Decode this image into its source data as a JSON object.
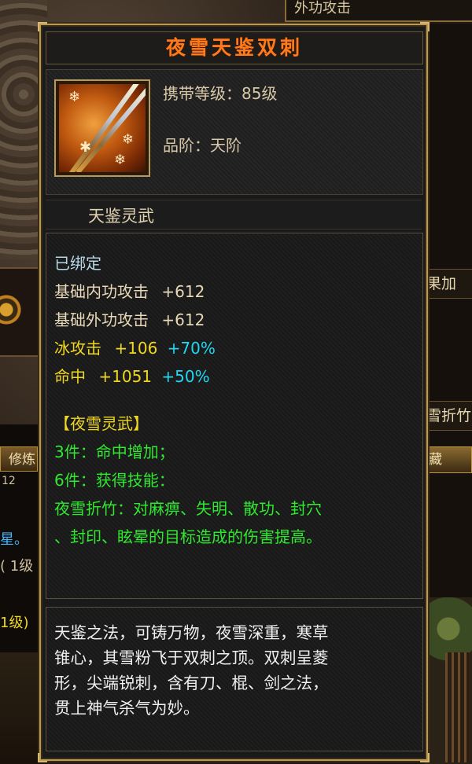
{
  "item": {
    "name": "夜雪天鉴双刺",
    "required_level": "携带等级：85级",
    "grade": "品阶：天阶",
    "set_category": "天鉴灵武"
  },
  "stats": {
    "bound": "已绑定",
    "inner_attack": {
      "label": "基础内功攻击",
      "value": "+612"
    },
    "outer_attack": {
      "label": "基础外功攻击",
      "value": "+612"
    },
    "ice_attack": {
      "label": "冰攻击",
      "value": "+106",
      "bonus": "+70%"
    },
    "hit": {
      "label": "命中",
      "value": "+1051",
      "bonus": "+50%"
    }
  },
  "set_bonus": {
    "title": "【夜雪灵武】",
    "piece3": "3件：命中增加；",
    "piece6": "6件：获得技能：",
    "skill_line1": "夜雪折竹：对麻痹、失明、散功、封穴",
    "skill_line2": "、封印、眩晕的目标造成的伤害提高。"
  },
  "description": {
    "line1": "天鉴之法，可铸万物，夜雪深重，寒草",
    "line2": "锥心，其雪粉飞于双刺之顶。双刺呈菱",
    "line3": "形，尖端锐刺，含有刀、棍、剑之法，",
    "line4": "贯上神气杀气为妙。"
  },
  "background": {
    "top_right_tab": "外功攻击",
    "right_label_1": "果加",
    "right_label_2": "雪折竹",
    "right_button": "藏",
    "left_button": "修炼",
    "left_text_1": "12",
    "left_text_2": "星。",
    "left_text_3": "( 1级",
    "left_text_4": "1级)"
  },
  "colors": {
    "title": "#ff7a1a",
    "set_yellow": "#f0d820",
    "bonus_cyan": "#20d8f0",
    "set_green": "#30e830",
    "border_gold": "#b89a5a"
  },
  "icon": "twin-daggers-icon"
}
